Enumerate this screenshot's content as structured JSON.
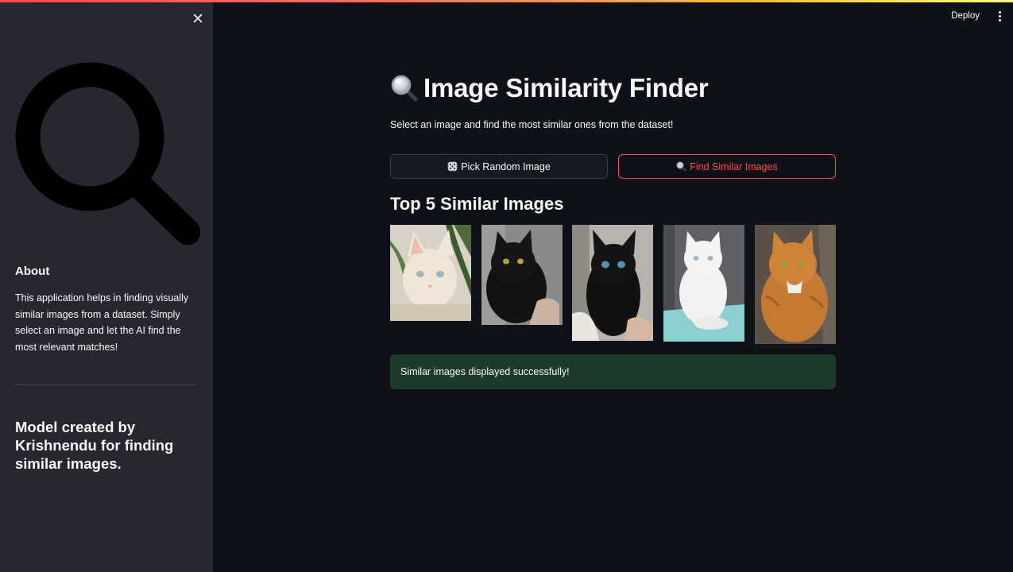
{
  "header": {
    "deploy_label": "Deploy",
    "menu_icon": "kebab-menu-icon",
    "accent_gradient": [
      "#ff4b4b",
      "#ffbd45",
      "#fffd80"
    ]
  },
  "sidebar": {
    "close_icon": "close-icon",
    "logo_icon": "magnifier-icon",
    "about_heading": "About",
    "about_text": "This application helps in finding visually similar images from a dataset. Simply select an image and let the AI find the most relevant matches!",
    "credit": "Model created by Krishnendu for finding similar images."
  },
  "main": {
    "title_icon": "magnifying-glass-icon",
    "title": "Image Similarity Finder",
    "subtitle": "Select an image and find the most similar ones from the dataset!",
    "buttons": {
      "random": {
        "icon": "die-icon",
        "label": "Pick Random Image"
      },
      "find": {
        "icon": "magnifying-glass-icon",
        "label": "Find Similar Images"
      }
    },
    "results_heading": "Top 5 Similar Images",
    "results": [
      {
        "subject": "cream kitten"
      },
      {
        "subject": "black cat"
      },
      {
        "subject": "black kitten"
      },
      {
        "subject": "white cat"
      },
      {
        "subject": "orange tabby cat"
      }
    ],
    "success_message": "Similar images displayed successfully!"
  },
  "colors": {
    "background": "#0e1117",
    "sidebar": "#262730",
    "primary": "#ff4b4b",
    "success_bg": "#1f3a2b"
  }
}
